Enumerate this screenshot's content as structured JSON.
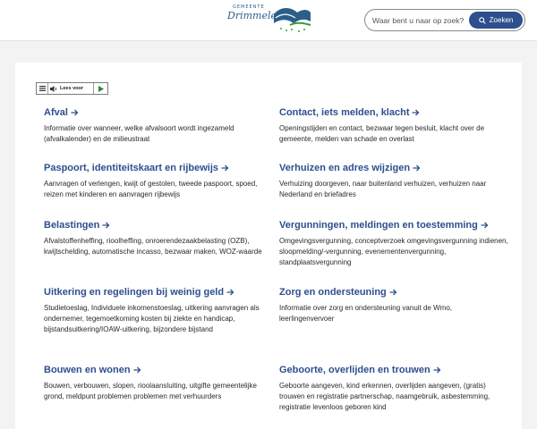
{
  "header": {
    "logo_small": "GEMEENTE",
    "logo_name": "Drimmelen",
    "search_placeholder": "Waar bent u naar op zoek?",
    "search_button": "Zoeken"
  },
  "readspeaker": {
    "label": "Lees voor"
  },
  "colors": {
    "accent": "#2d4f8e",
    "page_bg": "#f3f3f3"
  },
  "tiles": [
    {
      "title": "Afval",
      "desc": "Informatie over wanneer, welke afvalsoort wordt ingezameld (afvalkalender) en de milieustraat"
    },
    {
      "title": "Contact, iets melden, klacht",
      "desc": "Openingstijden en contact, bezwaar tegen besluit, klacht over de gemeente, melden van schade en overlast"
    },
    {
      "title": "Paspoort, identiteitskaart en rijbewijs",
      "desc": "Aanvragen of verlengen, kwijt of gestolen, tweede paspoort, spoed, reizen met kinderen en aanvragen rijbewijs"
    },
    {
      "title": "Verhuizen en adres wijzigen",
      "desc": "Verhuizing doorgeven, naar buitenland verhuizen, verhuizen naar Nederland en briefadres"
    },
    {
      "title": "Belastingen",
      "desc": "Afvalstoffenheffing, rioolheffing, onroerendezaakbelasting (OZB), kwijtschelding, automatische incasso, bezwaar maken, WOZ-waarde"
    },
    {
      "title": "Vergunningen, meldingen en toestemming",
      "desc": "Omgevingsvergunning, conceptverzoek omgevingsvergunning indienen, sloopmelding/-vergunning, evenementenvergunning, standplaatsvergunning"
    },
    {
      "title": "Uitkering en regelingen bij weinig geld",
      "desc": "Studietoeslag, Individuele inkomenstoeslag, uitkering aanvragen als ondernemer, tegemoetkoming kosten bij ziekte en handicap, bijstandsuitkering/IOAW-uitkering, bijzondere bijstand"
    },
    {
      "title": "Zorg en ondersteuning",
      "desc": "Informatie over zorg en ondersteuning vanuit de Wmo, leerlingenvervoer"
    },
    {
      "title": "Bouwen en wonen",
      "desc": "Bouwen, verbouwen, slopen, rioolaansluiting, uitgifte gemeentelijke grond, meldpunt problemen problemen met verhuurders"
    },
    {
      "title": "Geboorte, overlijden en trouwen",
      "desc": "Geboorte aangeven, kind erkennen, overlijden aangeven, (gratis) trouwen en registratie partnerschap, naamgebruik, asbestemming, registratie levenloos geboren kind"
    }
  ]
}
